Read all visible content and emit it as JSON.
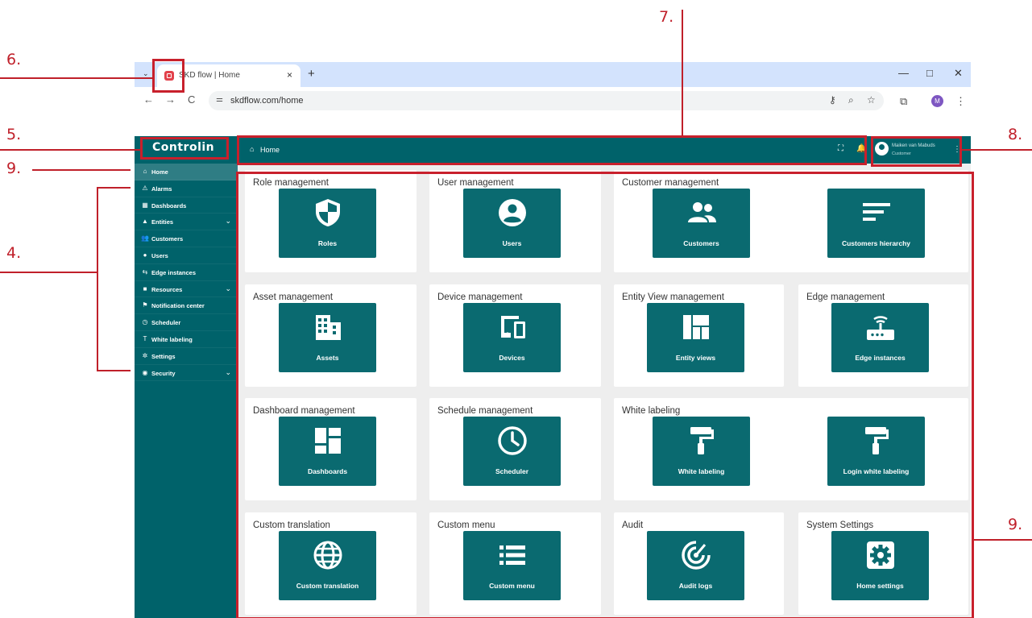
{
  "annotations": {
    "n4": "4.",
    "n5": "5.",
    "n6": "6.",
    "n7": "7.",
    "n8": "8.",
    "n9_left": "9.",
    "n9_right": "9."
  },
  "browser": {
    "tab_title": "SKD flow | Home",
    "tab_close": "×",
    "new_tab": "+",
    "tab_search": "⌄",
    "minimize": "—",
    "maximize": "□",
    "close": "✕",
    "back": "←",
    "forward": "→",
    "reload": "C",
    "url": "skdflow.com/home",
    "profile_initial": "M"
  },
  "app": {
    "logo": "Controlin",
    "breadcrumb": "Home",
    "user_name": "Maiken van Mabuds",
    "user_role": "Customer"
  },
  "sidebar": {
    "items": [
      {
        "label": "Home",
        "icon": "⌂",
        "chevron": ""
      },
      {
        "label": "Alarms",
        "icon": "⚠",
        "chevron": ""
      },
      {
        "label": "Dashboards",
        "icon": "▦",
        "chevron": ""
      },
      {
        "label": "Entities",
        "icon": "▲",
        "chevron": "⌄"
      },
      {
        "label": "Customers",
        "icon": "👥",
        "chevron": ""
      },
      {
        "label": "Users",
        "icon": "●",
        "chevron": ""
      },
      {
        "label": "Edge instances",
        "icon": "⇆",
        "chevron": ""
      },
      {
        "label": "Resources",
        "icon": "■",
        "chevron": "⌄"
      },
      {
        "label": "Notification center",
        "icon": "⚑",
        "chevron": ""
      },
      {
        "label": "Scheduler",
        "icon": "◷",
        "chevron": ""
      },
      {
        "label": "White labeling",
        "icon": "T",
        "chevron": ""
      },
      {
        "label": "Settings",
        "icon": "✲",
        "chevron": ""
      },
      {
        "label": "Security",
        "icon": "◉",
        "chevron": "⌄"
      }
    ]
  },
  "cards": [
    {
      "title": "Role management",
      "tiles": [
        {
          "label": "Roles",
          "icon": "shield-icon"
        }
      ]
    },
    {
      "title": "User management",
      "tiles": [
        {
          "label": "Users",
          "icon": "user-icon"
        }
      ]
    },
    {
      "title": "Customer management",
      "tiles": [
        {
          "label": "Customers",
          "icon": "people-icon"
        },
        {
          "label": "Customers hierarchy",
          "icon": "hierarchy-icon"
        }
      ]
    },
    {
      "title": "Asset management",
      "tiles": [
        {
          "label": "Assets",
          "icon": "building-icon"
        }
      ]
    },
    {
      "title": "Device management",
      "tiles": [
        {
          "label": "Devices",
          "icon": "devices-icon"
        }
      ]
    },
    {
      "title": "Entity View management",
      "tiles": [
        {
          "label": "Entity views",
          "icon": "entity-view-icon"
        }
      ]
    },
    {
      "title": "Edge management",
      "tiles": [
        {
          "label": "Edge instances",
          "icon": "router-icon"
        }
      ]
    },
    {
      "title": "Dashboard management",
      "tiles": [
        {
          "label": "Dashboards",
          "icon": "dashboard-icon"
        }
      ]
    },
    {
      "title": "Schedule management",
      "tiles": [
        {
          "label": "Scheduler",
          "icon": "clock-icon"
        }
      ]
    },
    {
      "title": "White labeling",
      "tiles": [
        {
          "label": "White labeling",
          "icon": "paint-roller-icon"
        },
        {
          "label": "Login white labeling",
          "icon": "paint-roller-icon"
        }
      ]
    },
    {
      "title": "Custom translation",
      "tiles": [
        {
          "label": "Custom translation",
          "icon": "globe-icon"
        }
      ]
    },
    {
      "title": "Custom menu",
      "tiles": [
        {
          "label": "Custom menu",
          "icon": "menu-list-icon"
        }
      ]
    },
    {
      "title": "Audit",
      "tiles": [
        {
          "label": "Audit logs",
          "icon": "audit-icon"
        }
      ]
    },
    {
      "title": "System Settings",
      "tiles": [
        {
          "label": "Home settings",
          "icon": "gear-icon"
        }
      ]
    }
  ]
}
